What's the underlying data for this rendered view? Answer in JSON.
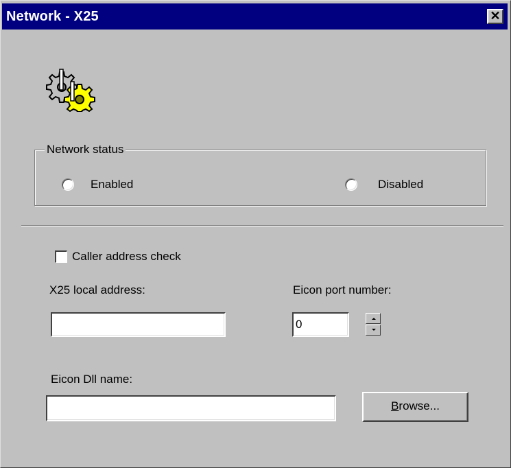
{
  "window": {
    "title": "Network - X25",
    "close_glyph": "✕"
  },
  "icons": {
    "header": "gears-icon",
    "close": "close-icon"
  },
  "network_status": {
    "group_label": "Network status",
    "options": [
      {
        "label": "Enabled",
        "selected": false
      },
      {
        "label": "Disabled",
        "selected": false
      }
    ]
  },
  "caller_check": {
    "label": "Caller address check",
    "checked": false
  },
  "x25_address": {
    "label": "X25 local address:",
    "value": ""
  },
  "eicon_port": {
    "label": "Eicon port number:",
    "value": "0"
  },
  "eicon_dll": {
    "label": "Eicon Dll name:",
    "value": ""
  },
  "browse_button": {
    "mnemonic": "B",
    "rest": "rowse..."
  },
  "colors": {
    "titlebar": "#000080",
    "face": "#c0c0c0",
    "gear_yellow": "#ffff00"
  }
}
